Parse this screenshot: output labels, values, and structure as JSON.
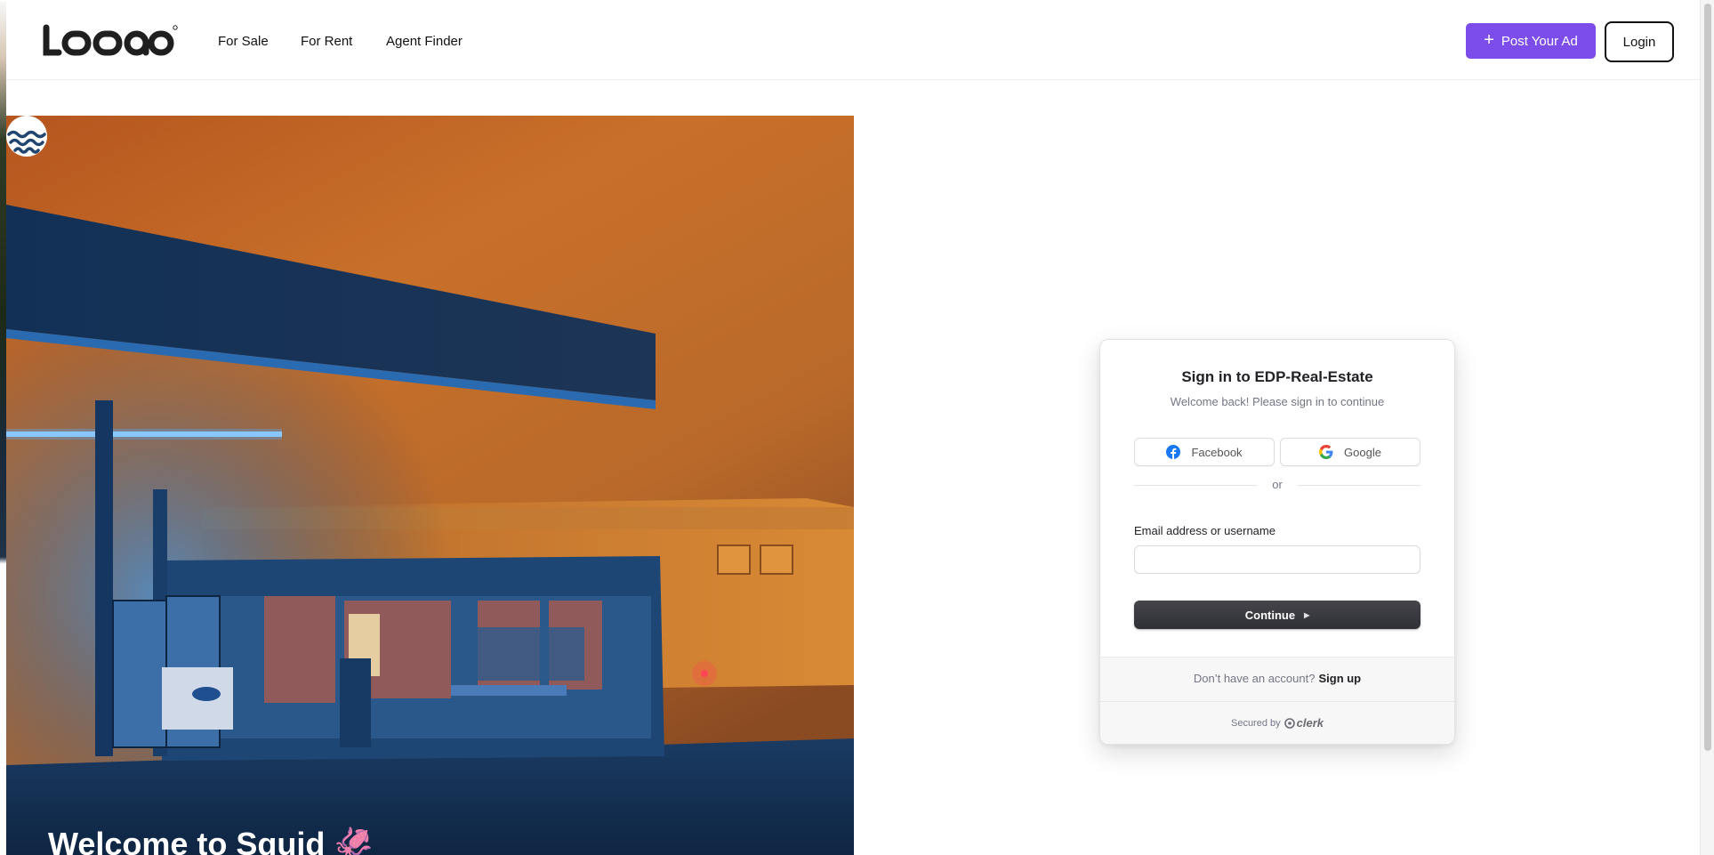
{
  "header": {
    "logo_text": "LOGO",
    "nav": [
      "For Sale",
      "For Rent",
      "Agent Finder"
    ],
    "post_ad_label": "Post Your Ad",
    "login_label": "Login",
    "accent_color": "#7c4dea"
  },
  "hero": {
    "title": "Welcome to Squid 🦑",
    "logo_icon": "wave-logo-icon",
    "image": "gas-station-night-photo"
  },
  "signin": {
    "title": "Sign in to EDP-Real-Estate",
    "subtitle": "Welcome back! Please sign in to continue",
    "facebook_label": "Facebook",
    "google_label": "Google",
    "or_label": "or",
    "email_label": "Email address or username",
    "email_value": "",
    "continue_label": "Continue",
    "no_account_text": "Don’t have an account?",
    "signup_label": "Sign up",
    "secured_by": "Secured by",
    "clerk_label": "clerk"
  }
}
